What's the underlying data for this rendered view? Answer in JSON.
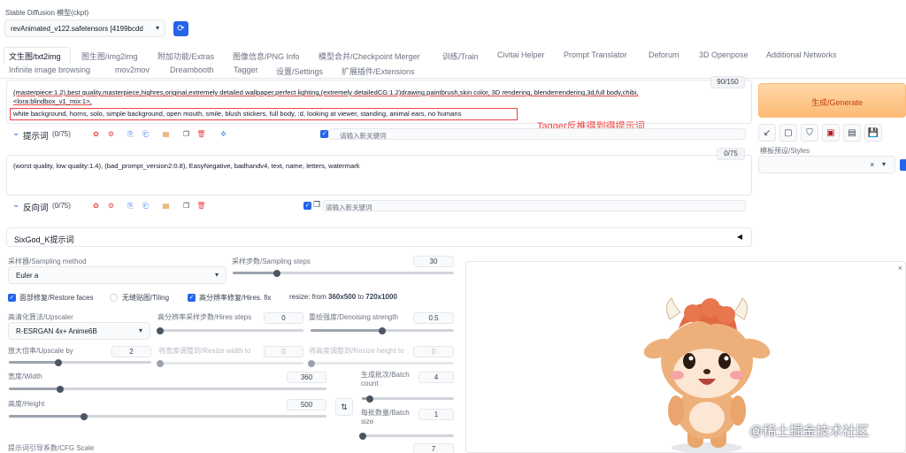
{
  "checkpoint": {
    "label": "Stable Diffusion 模型(ckpt)",
    "value": "revAnimated_v122.safetensors [4199bcdd"
  },
  "tabs": {
    "row1": [
      "文生图/txt2img",
      "图生图/img2img",
      "附加功能/Extras",
      "图像信息/PNG Info",
      "模型合并/Checkpoint Merger",
      "训练/Train",
      "Civitai Helper",
      "Prompt Translator",
      "Deforum",
      "3D Openpose",
      "Additional Networks"
    ],
    "row2": [
      "Infinite image browsing",
      "mov2mov",
      "Dreambooth",
      "Tagger",
      "设置/Settings",
      "扩展插件/Extensions"
    ]
  },
  "prompt": {
    "counter": "90/150",
    "line1a": "(masterpiece:1.2),best quality,masterpiece,highres,original,extremely detailed wallpaper,perfect lighting,(extremely detailedCG:1.2)drawing,paintbrush,skin color, 3D rendering, blenderrendering,3d,full body,chibi,",
    "line1b": "<lora:blindbox_v1_mix:1>,",
    "line2": "white background, horns, solo, simple background, open mouth, smile, blush stickers, full body, :d, looking at viewer, standing, animal ears, no humans",
    "label": "提示词",
    "count": "(0/75)",
    "keyword_placeholder": "请输入新关键词"
  },
  "annotation": "Tagger反推得到得提示词",
  "negative": {
    "counter": "0/75",
    "text": "(worst quality, low quality:1.4), (bad_prompt_version2:0.8), EasyNegative, badhandv4, text, name, letters, watermark",
    "label": "反向词",
    "count": "(0/75)",
    "keyword_placeholder": "请输入新关键词"
  },
  "generate": {
    "label": "生成/Generate"
  },
  "styles": {
    "label": "模板预设/Styles",
    "clear": "×",
    "chevron": "▾"
  },
  "sixgod": {
    "label": "SixGod_K提示词",
    "arrow": "◀"
  },
  "sampling": {
    "method_label": "采样器/Sampling method",
    "method_value": "Euler a",
    "steps_label": "采样步数/Sampling steps",
    "steps_value": "30",
    "steps_level": 0.2
  },
  "checks": {
    "restore_faces": "面部修复/Restore faces",
    "tiling": "无缝贴图/Tiling",
    "hires_fix": "高分辨率修复/Hires. fix",
    "resize_prefix": "resize: from ",
    "resize_from": "360x500",
    "resize_to_word": " to ",
    "resize_to": "720x1000"
  },
  "hires": {
    "upscaler_label": "高清化算法/Upscaler",
    "upscaler_value": "R-ESRGAN 4x+ Anime6B",
    "steps_label": "高分辨率采样步数/Hires steps",
    "steps_value": "0",
    "denoise_label": "重绘强度/Denoising strength",
    "denoise_value": "0.5",
    "upscale_label": "放大倍率/Upscale by",
    "upscale_value": "2",
    "resize_w_label": "将宽度调整到/Resize width to",
    "resize_w_value": "0",
    "resize_h_label": "将高度调整到/Resize height to",
    "resize_h_value": "0"
  },
  "size": {
    "width_label": "宽度/Width",
    "width_value": "360",
    "height_label": "高度/Height",
    "height_value": "500",
    "swap": "⇅"
  },
  "batch": {
    "count_label": "生成批次/Batch count",
    "count_value": "4",
    "size_label": "每批数量/Batch size",
    "size_value": "1"
  },
  "cfg": {
    "label": "提示词引导系数/CFG Scale",
    "value": "7"
  },
  "image_close": "×",
  "watermark": "@稀土掘金技术社区",
  "colors": {
    "accent": "#f97316",
    "annotation_red": "#ef4444",
    "checkbox_blue": "#2563eb"
  }
}
